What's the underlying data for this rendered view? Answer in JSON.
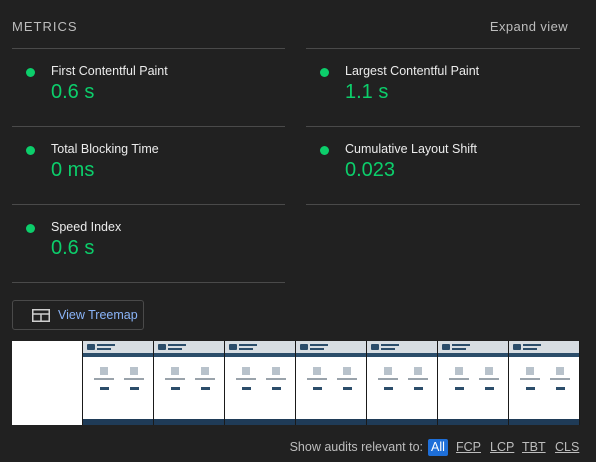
{
  "header": {
    "title": "METRICS",
    "expand_label": "Expand view"
  },
  "metrics": [
    {
      "label": "First Contentful Paint",
      "value": "0.6 s",
      "status": "pass"
    },
    {
      "label": "Largest Contentful Paint",
      "value": "1.1 s",
      "status": "pass"
    },
    {
      "label": "Total Blocking Time",
      "value": "0 ms",
      "status": "pass"
    },
    {
      "label": "Cumulative Layout Shift",
      "value": "0.023",
      "status": "pass"
    },
    {
      "label": "Speed Index",
      "value": "0.6 s",
      "status": "pass"
    }
  ],
  "treemap": {
    "label": "View Treemap",
    "icon": "treemap-icon"
  },
  "filmstrip": {
    "frame_count": 8
  },
  "audits_filter": {
    "label": "Show audits relevant to:",
    "options": [
      "All",
      "FCP",
      "LCP",
      "TBT",
      "CLS"
    ],
    "selected": "All"
  },
  "colors": {
    "background": "#212121",
    "pass": "#0cce6b",
    "link": "#8ab4f8",
    "active_chip": "#1e6fd9"
  }
}
